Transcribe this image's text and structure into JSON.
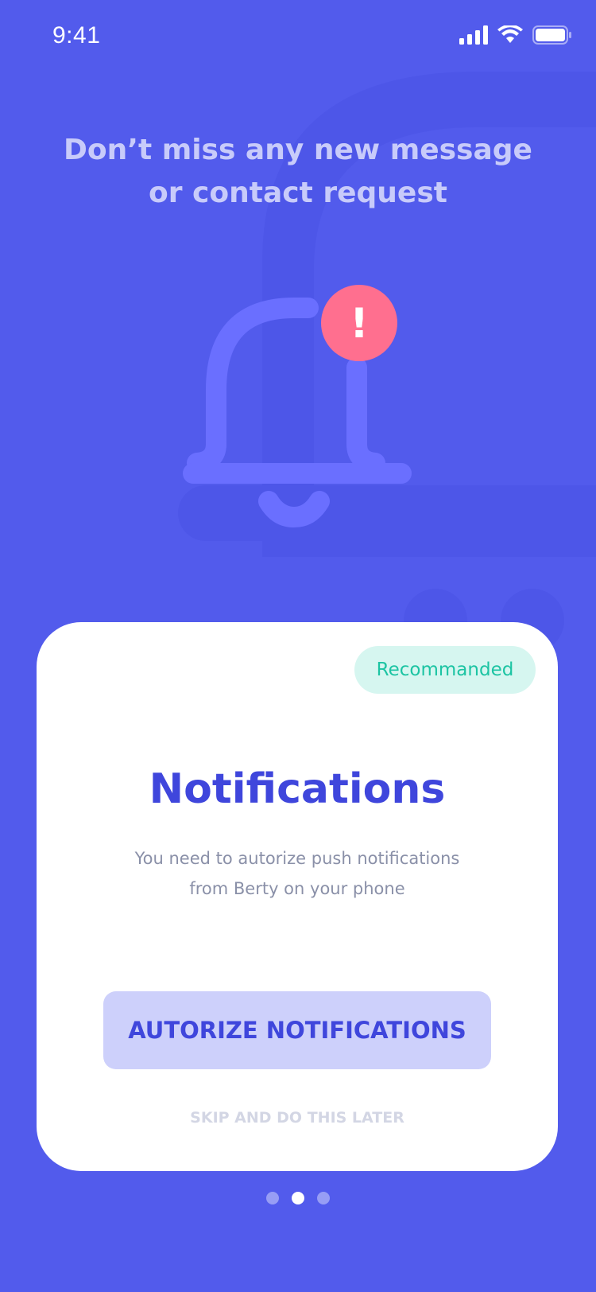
{
  "status_bar": {
    "time": "9:41",
    "icons": [
      "cellular-signal-icon",
      "wifi-icon",
      "battery-icon"
    ]
  },
  "headline": {
    "line1": "Don’t miss any new message",
    "line2": "or contact request"
  },
  "illustration": {
    "icon": "bell-icon",
    "alert_icon": "exclamation-icon",
    "alert_symbol": "!"
  },
  "card": {
    "badge": "Recommanded",
    "title": "Notifications",
    "description_line1": "You need to autorize push notifications",
    "description_line2": "from Berty on your phone",
    "primary_button": "AUTORIZE NOTIFICATIONS",
    "skip_link": "SKIP AND DO THIS LATER"
  },
  "pager": {
    "pages": 3,
    "current": 2
  },
  "colors": {
    "background": "#525BEC",
    "accent": "#3F46DC",
    "badge_text": "#1CC4A3",
    "badge_bg": "#D6F6F0",
    "alert": "#FF6F8F"
  }
}
